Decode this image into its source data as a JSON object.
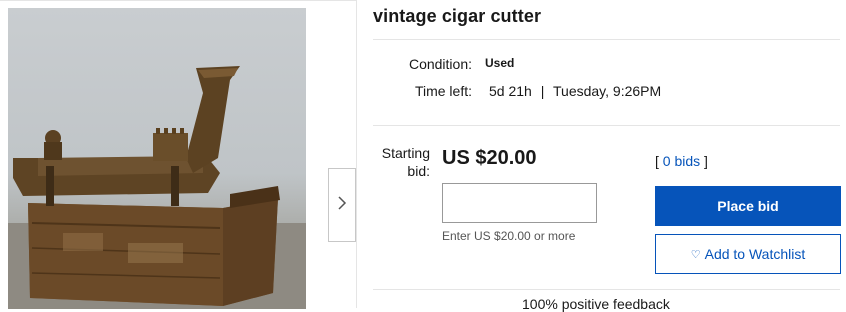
{
  "item": {
    "title": "vintage cigar cutter"
  },
  "details": {
    "condition_label": "Condition:",
    "condition_value": "Used",
    "time_left_label": "Time left:",
    "time_left_value": "5d 21h",
    "time_separator": "|",
    "end_time": "Tuesday, 9:26PM"
  },
  "bidding": {
    "starting_label_line1": "Starting",
    "starting_label_line2": "bid:",
    "price": "US $20.00",
    "bids_open": "[",
    "bids_link": "0 bids",
    "bids_close": "]",
    "input_value": "",
    "hint": "Enter US $20.00 or more",
    "place_bid_label": "Place bid",
    "watchlist_label": "Add to Watchlist"
  },
  "seller": {
    "feedback": "100% positive feedback"
  },
  "gallery": {
    "next_icon": "chevron-right-icon",
    "photo_alt": "vintage cigar cutter photo"
  },
  "colors": {
    "accent": "#0654ba",
    "text": "#191919",
    "divider": "#e5e5e5"
  }
}
